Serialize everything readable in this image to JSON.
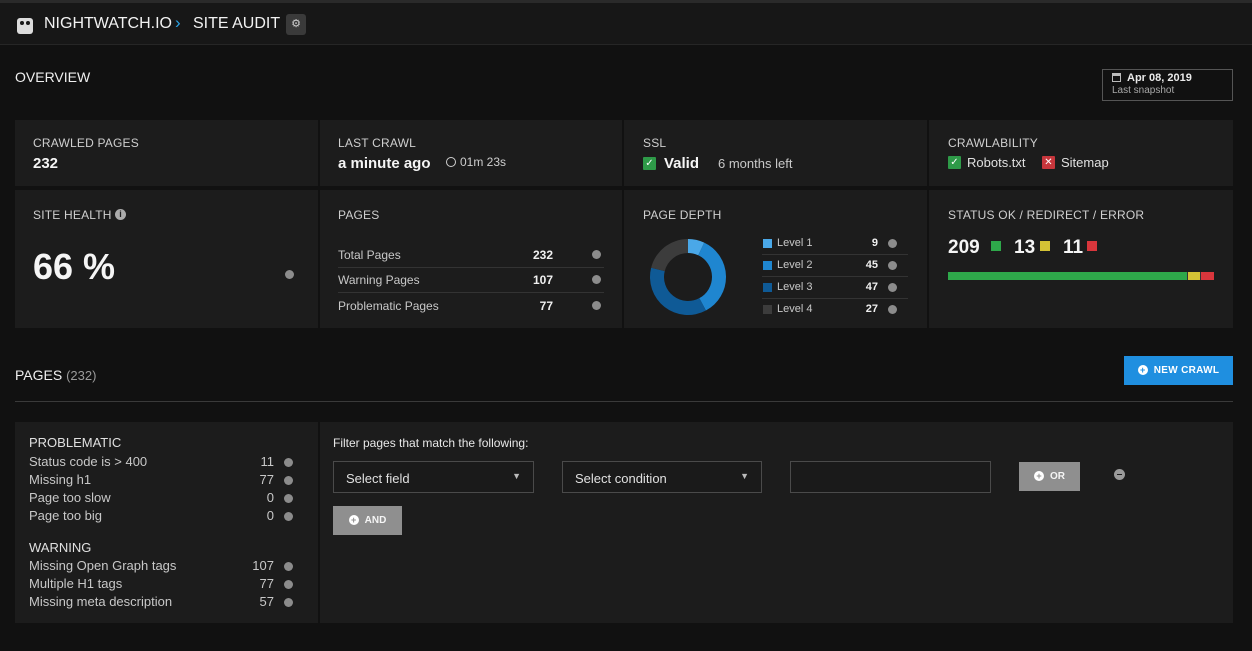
{
  "header": {
    "brand": "NIGHTWATCH.IO",
    "separator": "›",
    "crumb": "SITE AUDIT"
  },
  "overview": {
    "title": "OVERVIEW",
    "snapshot_date": "Apr 08, 2019",
    "snapshot_label": "Last snapshot",
    "crawled_pages": {
      "label": "CRAWLED PAGES",
      "value": "232"
    },
    "last_crawl": {
      "label": "LAST CRAWL",
      "value": "a minute ago",
      "duration": "01m 23s"
    },
    "ssl": {
      "label": "SSL",
      "status": "Valid",
      "note": "6 months left"
    },
    "crawlability": {
      "label": "CRAWLABILITY",
      "robots": "Robots.txt",
      "sitemap": "Sitemap"
    },
    "site_health": {
      "label": "SITE HEALTH",
      "value": "66 %"
    },
    "pages": {
      "label": "PAGES",
      "rows": [
        {
          "name": "Total Pages",
          "value": "232"
        },
        {
          "name": "Warning Pages",
          "value": "107"
        },
        {
          "name": "Problematic Pages",
          "value": "77"
        }
      ]
    },
    "page_depth": {
      "label": "PAGE DEPTH",
      "levels": [
        {
          "name": "Level 1",
          "value": "9",
          "color": "#4aa8e8"
        },
        {
          "name": "Level 2",
          "value": "45",
          "color": "#1f86d0"
        },
        {
          "name": "Level 3",
          "value": "47",
          "color": "#0f5a96"
        },
        {
          "name": "Level 4",
          "value": "27",
          "color": "#3c3c3c"
        }
      ]
    },
    "status": {
      "label": "STATUS OK / REDIRECT / ERROR",
      "ok": "209",
      "redirect": "13",
      "error": "11",
      "ok_color": "#2ea84a",
      "redirect_color": "#d4c235",
      "error_color": "#d9363c"
    }
  },
  "pages_section": {
    "title": "PAGES",
    "count": "(232)",
    "new_crawl_label": "NEW CRAWL"
  },
  "filters_list": {
    "problematic_title": "PROBLEMATIC",
    "problematic": [
      {
        "name": "Status code is > 400",
        "value": "11"
      },
      {
        "name": "Missing h1",
        "value": "77"
      },
      {
        "name": "Page too slow",
        "value": "0"
      },
      {
        "name": "Page too big",
        "value": "0"
      }
    ],
    "warning_title": "WARNING",
    "warning": [
      {
        "name": "Missing Open Graph tags",
        "value": "107"
      },
      {
        "name": "Multiple H1 tags",
        "value": "77"
      },
      {
        "name": "Missing meta description",
        "value": "57"
      }
    ]
  },
  "filter_builder": {
    "heading": "Filter pages that match the following:",
    "field_select": "Select field",
    "condition_select": "Select condition",
    "value_input": "",
    "or_label": "OR",
    "and_label": "AND"
  }
}
